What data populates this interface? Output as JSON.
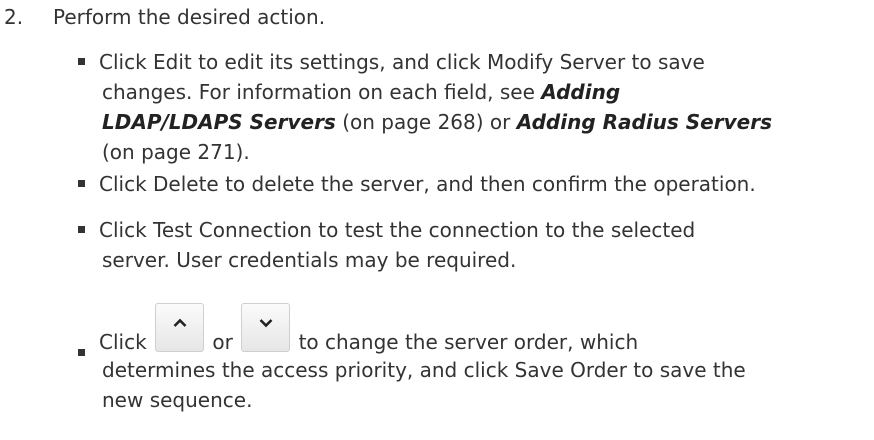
{
  "step": {
    "number": "2.",
    "text": "Perform the desired action."
  },
  "bullets": {
    "edit": {
      "line1": "Click Edit to edit its settings, and click Modify Server to save",
      "line2_pre": "changes. For information on each field, see ",
      "link1": "Adding",
      "link1_cont": "LDAP/LDAPS Servers",
      "line3_mid": " (on page 268) or ",
      "link2": "Adding Radius Servers",
      "line4": "(on page 271)."
    },
    "delete": {
      "line1": "Click Delete to delete the server, and then confirm the operation."
    },
    "test": {
      "line1": "Click Test Connection to test the connection to the selected",
      "line2": "server. User credentials may be required."
    },
    "order": {
      "pre": "Click",
      "or": "or",
      "post": "to change the server order, which",
      "line2": "determines the access priority, and click Save Order to save the",
      "line3": "new sequence.",
      "up_icon": "chevron-up-icon",
      "down_icon": "chevron-down-icon"
    }
  }
}
